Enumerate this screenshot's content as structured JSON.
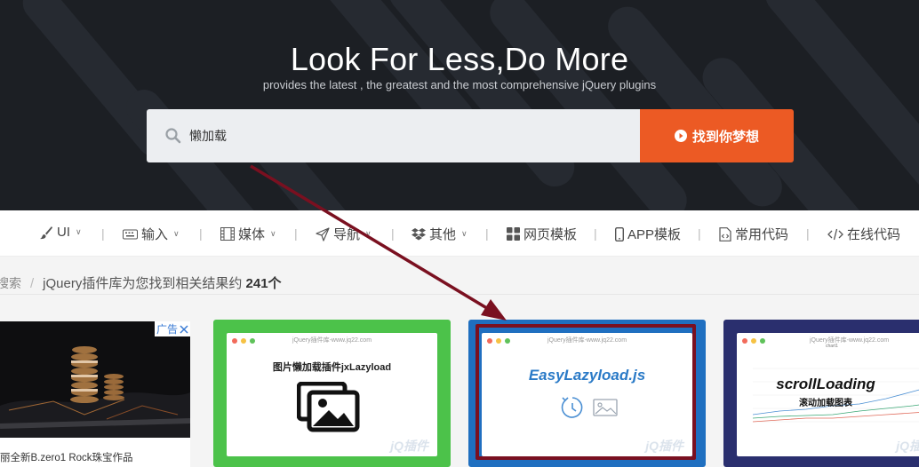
{
  "hero": {
    "title": "Look For Less,Do More",
    "subtitle": "provides the latest , the greatest and the most comprehensive jQuery plugins"
  },
  "search": {
    "value": "懒加载",
    "button_label": "找到你梦想",
    "accent_color": "#ec5a24"
  },
  "nav": {
    "items": [
      {
        "label": "UI",
        "icon": "brush-icon",
        "dropdown": true
      },
      {
        "label": "输入",
        "icon": "keyboard-icon",
        "dropdown": true
      },
      {
        "label": "媒体",
        "icon": "film-icon",
        "dropdown": true
      },
      {
        "label": "导航",
        "icon": "send-icon",
        "dropdown": true
      },
      {
        "label": "其他",
        "icon": "dropbox-icon",
        "dropdown": true
      },
      {
        "label": "网页模板",
        "icon": "grid-icon",
        "dropdown": false
      },
      {
        "label": "APP模板",
        "icon": "mobile-icon",
        "dropdown": false
      },
      {
        "label": "常用代码",
        "icon": "file-code-icon",
        "dropdown": false
      },
      {
        "label": "在线代码",
        "icon": "code-icon",
        "dropdown": false
      }
    ]
  },
  "breadcrumb": {
    "prefix": "搜索",
    "text": "jQuery插件库为您找到相关结果约",
    "count": "241个"
  },
  "ad": {
    "badge": "广告",
    "caption": "丽全新B.zero1 Rock珠宝作品"
  },
  "cards": [
    {
      "url": "jQuery插件库-www.jq22.com",
      "title": "图片懒加载插件jxLazyload",
      "color": "#4cc24a"
    },
    {
      "url": "jQuery插件库-www.jq22.com",
      "title": "EasyLazyload.js",
      "color": "#1f6fc0",
      "highlight": "#7a1020"
    },
    {
      "url": "jQuery插件库-www.jq22.com",
      "title": "scrollLoading",
      "subtitle": "滚动加载图表",
      "chart_heading": "chart1",
      "color": "#2a2f6e"
    }
  ],
  "watermark": "jQ插件"
}
